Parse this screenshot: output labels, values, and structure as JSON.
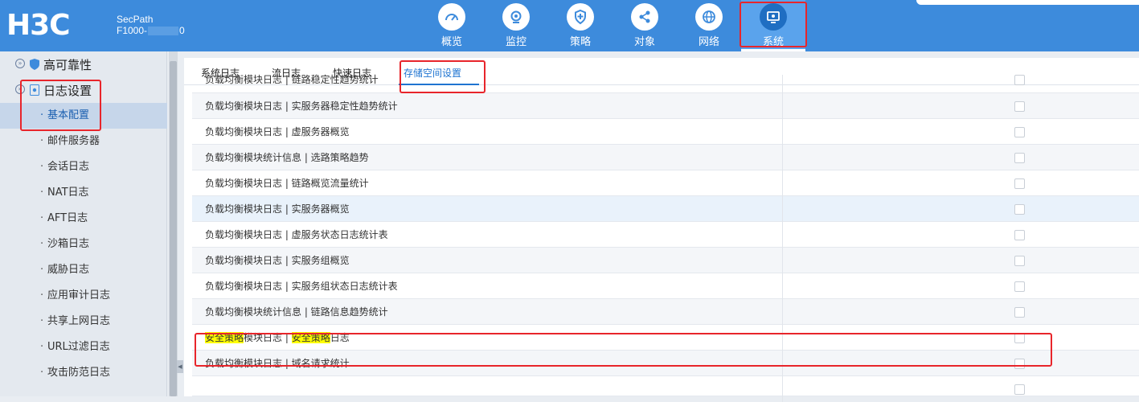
{
  "header": {
    "logo_text": "H3C",
    "product_line1": "SecPath",
    "product_line2_prefix": "F1000-",
    "product_line2_suffix": "0",
    "nav": [
      {
        "label": "概览",
        "icon": "gauge-icon"
      },
      {
        "label": "监控",
        "icon": "camera-icon"
      },
      {
        "label": "策略",
        "icon": "shield-plus-icon"
      },
      {
        "label": "对象",
        "icon": "share-nodes-icon"
      },
      {
        "label": "网络",
        "icon": "globe-icon"
      },
      {
        "label": "系统",
        "icon": "monitor-gear-icon",
        "active": true
      }
    ]
  },
  "sidebar": {
    "groups": [
      {
        "label": "高可靠性",
        "icon": "shield-icon"
      },
      {
        "label": "日志设置",
        "icon": "document-gear-icon"
      }
    ],
    "items": [
      {
        "label": "基本配置",
        "active": true
      },
      {
        "label": "邮件服务器"
      },
      {
        "label": "会话日志"
      },
      {
        "label": "NAT日志"
      },
      {
        "label": "AFT日志"
      },
      {
        "label": "沙箱日志"
      },
      {
        "label": "威胁日志"
      },
      {
        "label": "应用审计日志"
      },
      {
        "label": "共享上网日志"
      },
      {
        "label": "URL过滤日志"
      },
      {
        "label": "攻击防范日志"
      }
    ]
  },
  "tabs": [
    {
      "label": "系统日志"
    },
    {
      "label": "流日志"
    },
    {
      "label": "快速日志"
    },
    {
      "label": "存储空间设置",
      "active": true
    }
  ],
  "rows": [
    {
      "name": "负载均衡模块日志 | 链路稳定性趋势统计"
    },
    {
      "name": "负载均衡模块日志 | 实服务器稳定性趋势统计"
    },
    {
      "name": "负载均衡模块日志 | 虚服务器概览"
    },
    {
      "name": "负载均衡模块统计信息 | 选路策略趋势"
    },
    {
      "name": "负载均衡模块日志 | 链路概览流量统计"
    },
    {
      "name": "负载均衡模块日志 | 实服务器概览"
    },
    {
      "name": "负载均衡模块日志 | 虚服务状态日志统计表"
    },
    {
      "name": "负载均衡模块日志 | 实服务组概览"
    },
    {
      "name": "负载均衡模块日志 | 实服务组状态日志统计表"
    },
    {
      "name": "负载均衡模块统计信息 | 链路信息趋势统计"
    },
    {
      "name_parts": [
        "安全策略",
        "模块日志 | ",
        "安全策略",
        "日志"
      ]
    },
    {
      "name": "负载均衡模块日志 | 域名请求统计"
    }
  ]
}
